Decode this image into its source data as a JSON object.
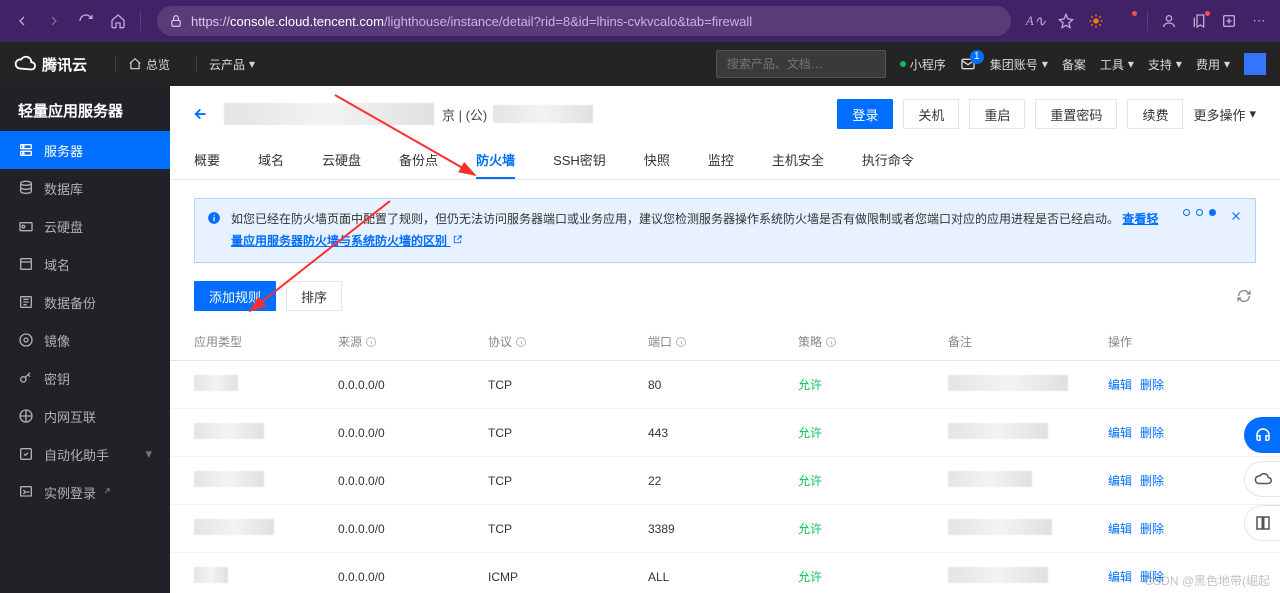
{
  "browser": {
    "url_host": "console.cloud.tencent.com",
    "url_rest": "/lighthouse/instance/detail?rid=8&id=lhins-cvkvcalo&tab=firewall"
  },
  "topbar": {
    "brand": "腾讯云",
    "overview": "总览",
    "products": "云产品",
    "search_ph": "搜索产品、文档…",
    "miniprog": "小程序",
    "group": "集团账号",
    "beian": "备案",
    "tools": "工具",
    "support": "支持",
    "fee": "费用",
    "msg_count": "1"
  },
  "sidebar": {
    "title": "轻量应用服务器",
    "items": [
      {
        "icon": "server",
        "label": "服务器",
        "active": true
      },
      {
        "icon": "db",
        "label": "数据库"
      },
      {
        "icon": "disk",
        "label": "云硬盘"
      },
      {
        "icon": "domain",
        "label": "域名"
      },
      {
        "icon": "backup",
        "label": "数据备份"
      },
      {
        "icon": "image",
        "label": "镜像"
      },
      {
        "icon": "key",
        "label": "密钥"
      },
      {
        "icon": "net",
        "label": "内网互联"
      },
      {
        "icon": "auto",
        "label": "自动化助手",
        "chev": true
      },
      {
        "icon": "login",
        "label": "实例登录",
        "ext": true
      }
    ]
  },
  "header": {
    "region": "京 | (公)",
    "login": "登录",
    "shutdown": "关机",
    "restart": "重启",
    "resetpw": "重置密码",
    "renew": "续费",
    "more": "更多操作"
  },
  "tabs": [
    "概要",
    "域名",
    "云硬盘",
    "备份点",
    "防火墙",
    "SSH密钥",
    "快照",
    "监控",
    "主机安全",
    "执行命令"
  ],
  "active_tab": 4,
  "notice": {
    "text_a": "如您已经在防火墙页面中配置了规则，但仍无法访问服务器端口或业务应用，建议您检测服务器操作系统防火墙是否有做限制或者您端口对应的应用进程是否已经启动。",
    "link": "查看轻量应用服务器防火墙与系统防火墙的区别"
  },
  "toolbar": {
    "add": "添加规则",
    "sort": "排序"
  },
  "thead": {
    "type": "应用类型",
    "source": "来源",
    "proto": "协议",
    "port": "端口",
    "policy": "策略",
    "remark": "备注",
    "ops": "操作"
  },
  "ops": {
    "edit": "编辑",
    "del": "删除"
  },
  "rows": [
    {
      "type_w": 44,
      "source": "0.0.0.0/0",
      "proto": "TCP",
      "port": "80",
      "policy": "允许",
      "rw": 120
    },
    {
      "type_w": 70,
      "source": "0.0.0.0/0",
      "proto": "TCP",
      "port": "443",
      "policy": "允许",
      "rw": 100
    },
    {
      "type_w": 70,
      "source": "0.0.0.0/0",
      "proto": "TCP",
      "port": "22",
      "policy": "允许",
      "rw": 84
    },
    {
      "type_w": 80,
      "source": "0.0.0.0/0",
      "proto": "TCP",
      "port": "3389",
      "policy": "允许",
      "rw": 104
    },
    {
      "type_w": 34,
      "source": "0.0.0.0/0",
      "proto": "ICMP",
      "port": "ALL",
      "policy": "允许",
      "rw": 100
    }
  ],
  "watermark": "CSDN @黑色地带(崛起"
}
